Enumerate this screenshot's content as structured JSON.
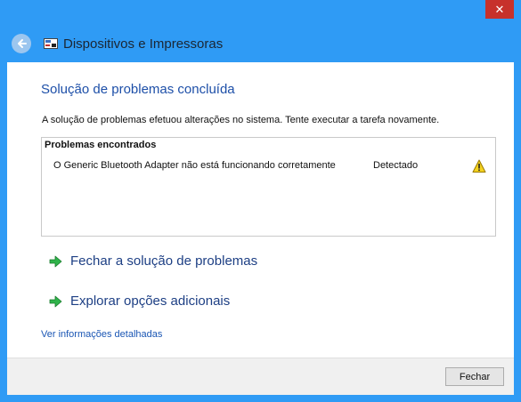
{
  "window": {
    "close_label": "✕"
  },
  "header": {
    "title": "Dispositivos e Impressoras"
  },
  "main": {
    "heading": "Solução de problemas concluída",
    "description": "A solução de problemas efetuou alterações no sistema. Tente executar a tarefa novamente.",
    "problems": {
      "title": "Problemas encontrados",
      "items": [
        {
          "text": "O Generic Bluetooth Adapter não está funcionando corretamente",
          "status": "Detectado",
          "icon": "warning-icon"
        }
      ]
    },
    "actions": [
      {
        "label": "Fechar a solução de problemas",
        "icon": "green-arrow-icon"
      },
      {
        "label": "Explorar opções adicionais",
        "icon": "green-arrow-icon"
      }
    ],
    "details_link": "Ver informações detalhadas"
  },
  "footer": {
    "close_button": "Fechar"
  },
  "colors": {
    "frame": "#2f9bf5",
    "heading": "#1d4fa8",
    "link": "#1a56b4",
    "close_button": "#c7312b"
  }
}
